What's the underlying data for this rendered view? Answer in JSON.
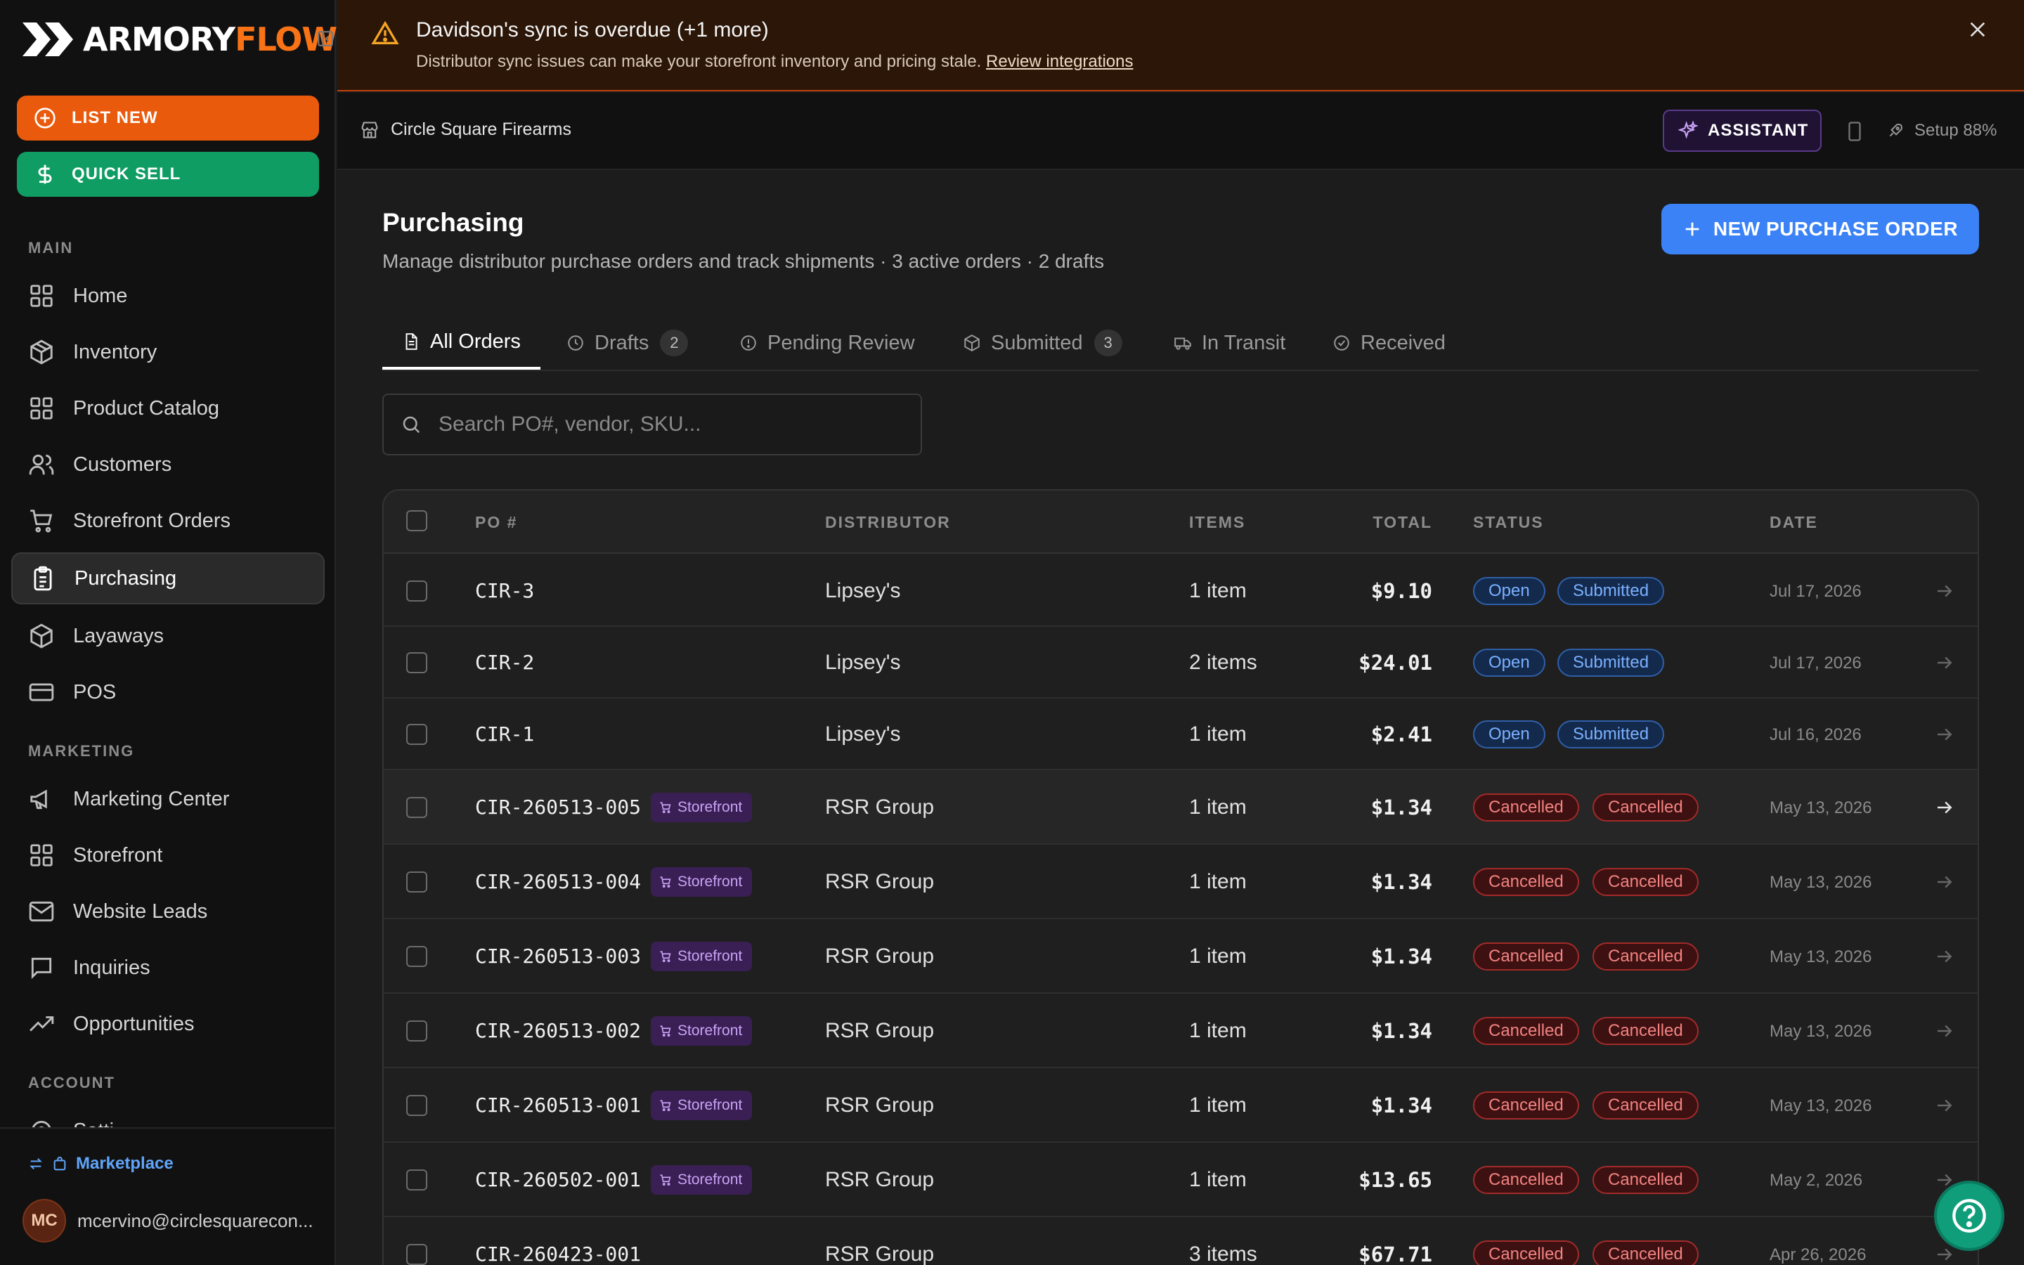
{
  "brand": {
    "logo_part1": "ARMORY",
    "logo_part2": "FLOW"
  },
  "sidebar": {
    "list_new": "LIST NEW",
    "quick_sell": "QUICK SELL",
    "section_main": "MAIN",
    "section_marketing": "MARKETING",
    "section_account": "ACCOUNT",
    "items": [
      {
        "label": "Home",
        "icon": "grid-icon"
      },
      {
        "label": "Inventory",
        "icon": "box-icon"
      },
      {
        "label": "Product Catalog",
        "icon": "grid-icon"
      },
      {
        "label": "Customers",
        "icon": "users-icon"
      },
      {
        "label": "Storefront Orders",
        "icon": "cart-icon"
      },
      {
        "label": "Purchasing",
        "icon": "clipboard-icon",
        "active": true
      },
      {
        "label": "Layaways",
        "icon": "box-icon"
      },
      {
        "label": "POS",
        "icon": "card-icon"
      },
      {
        "label": "Marketing Center",
        "icon": "megaphone-icon"
      },
      {
        "label": "Storefront",
        "icon": "grid-icon"
      },
      {
        "label": "Website Leads",
        "icon": "mail-icon"
      },
      {
        "label": "Inquiries",
        "icon": "chat-icon"
      },
      {
        "label": "Opportunities",
        "icon": "trending-icon"
      },
      {
        "label": "Setti",
        "icon": "gear-icon"
      }
    ],
    "marketplace": "Marketplace",
    "user_initials": "MC",
    "user_email": "mcervino@circlesquarecon..."
  },
  "alert": {
    "title": "Davidson's sync is overdue (+1 more)",
    "message": "Distributor sync issues can make your storefront inventory and pricing stale.",
    "link": "Review integrations"
  },
  "topbar": {
    "store_name": "Circle Square Firearms",
    "assistant": "ASSISTANT",
    "setup": "Setup 88%"
  },
  "page": {
    "title": "Purchasing",
    "subtitle": "Manage distributor purchase orders and track shipments · 3 active orders · 2 drafts",
    "new_po": "NEW PURCHASE ORDER"
  },
  "tabs": [
    {
      "label": "All Orders",
      "count": null
    },
    {
      "label": "Drafts",
      "count": "2"
    },
    {
      "label": "Pending Review",
      "count": null
    },
    {
      "label": "Submitted",
      "count": "3"
    },
    {
      "label": "In Transit",
      "count": null
    },
    {
      "label": "Received",
      "count": null
    }
  ],
  "search": {
    "placeholder": "Search PO#, vendor, SKU..."
  },
  "table": {
    "headers": {
      "po": "PO #",
      "distributor": "DISTRIBUTOR",
      "items": "ITEMS",
      "total": "TOTAL",
      "status": "STATUS",
      "date": "DATE"
    },
    "rows": [
      {
        "po": "CIR-3",
        "storefront": null,
        "distributor": "Lipsey's",
        "items": "1 item",
        "total": "$9.10",
        "status1": "Open",
        "status2": "Submitted",
        "date": "Jul 17, 2026"
      },
      {
        "po": "CIR-2",
        "storefront": null,
        "distributor": "Lipsey's",
        "items": "2 items",
        "total": "$24.01",
        "status1": "Open",
        "status2": "Submitted",
        "date": "Jul 17, 2026"
      },
      {
        "po": "CIR-1",
        "storefront": null,
        "distributor": "Lipsey's",
        "items": "1 item",
        "total": "$2.41",
        "status1": "Open",
        "status2": "Submitted",
        "date": "Jul 16, 2026"
      },
      {
        "po": "CIR-260513-005",
        "storefront": "Storefront",
        "distributor": "RSR Group",
        "items": "1 item",
        "total": "$1.34",
        "status1": "Cancelled",
        "status2": "Cancelled",
        "date": "May 13, 2026"
      },
      {
        "po": "CIR-260513-004",
        "storefront": "Storefront",
        "distributor": "RSR Group",
        "items": "1 item",
        "total": "$1.34",
        "status1": "Cancelled",
        "status2": "Cancelled",
        "date": "May 13, 2026"
      },
      {
        "po": "CIR-260513-003",
        "storefront": "Storefront",
        "distributor": "RSR Group",
        "items": "1 item",
        "total": "$1.34",
        "status1": "Cancelled",
        "status2": "Cancelled",
        "date": "May 13, 2026"
      },
      {
        "po": "CIR-260513-002",
        "storefront": "Storefront",
        "distributor": "RSR Group",
        "items": "1 item",
        "total": "$1.34",
        "status1": "Cancelled",
        "status2": "Cancelled",
        "date": "May 13, 2026"
      },
      {
        "po": "CIR-260513-001",
        "storefront": "Storefront",
        "distributor": "RSR Group",
        "items": "1 item",
        "total": "$1.34",
        "status1": "Cancelled",
        "status2": "Cancelled",
        "date": "May 13, 2026"
      },
      {
        "po": "CIR-260502-001",
        "storefront": "Storefront",
        "distributor": "RSR Group",
        "items": "1 item",
        "total": "$13.65",
        "status1": "Cancelled",
        "status2": "Cancelled",
        "date": "May 2, 2026"
      },
      {
        "po": "CIR-260423-001",
        "storefront": null,
        "distributor": "RSR Group",
        "items": "3 items",
        "total": "$67.71",
        "status1": "Cancelled",
        "status2": "Cancelled",
        "date": "Apr 26, 2026"
      }
    ]
  },
  "colors": {
    "accent_orange": "#ea5a0c",
    "accent_green": "#0f9d63",
    "accent_blue": "#3b82f6",
    "cancelled_red": "#f38282"
  }
}
